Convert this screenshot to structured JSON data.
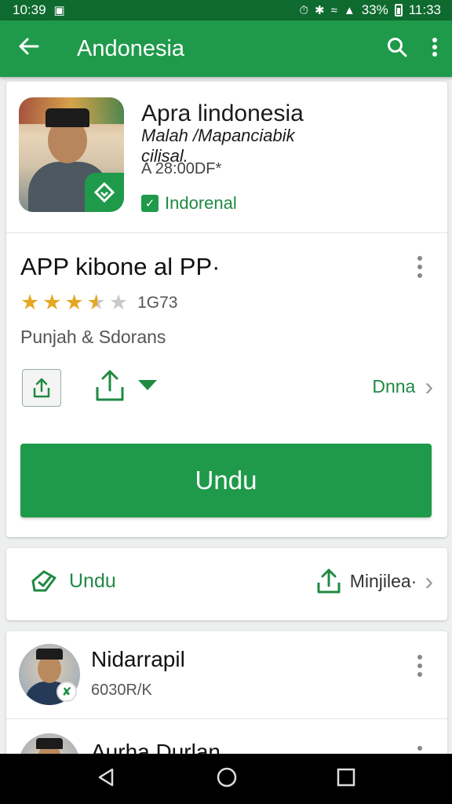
{
  "status_bar": {
    "time_left": "10:39",
    "battery": "33%",
    "time_right": "11:33"
  },
  "app_bar": {
    "title": "Andonesia",
    "icons": [
      "back-arrow-icon",
      "search-icon",
      "more-vert-icon"
    ]
  },
  "app_header": {
    "name": "Apra lindonesia",
    "subtitle": "Malah /Mapanciabik",
    "subtitle_2": "cilisal.",
    "size": "A 28:00DF*",
    "developer": "Indorenal"
  },
  "app_details": {
    "title": "APP kibone al PP·",
    "rating": 3.5,
    "rating_count": "1G73",
    "category": "Punjah & Sdorans",
    "more_link": "Dnna",
    "install_label": "Undu"
  },
  "download_row": {
    "left_label": "Undu",
    "right_label": "Minjilea·"
  },
  "list_items": [
    {
      "name": "Nidarrapil",
      "subtitle": "6030R/K"
    },
    {
      "name": "Aurha Durlan",
      "subtitle": ""
    }
  ],
  "colors": {
    "primary": "#1f9a4a",
    "primary_dark": "#0f6a30",
    "accent_text": "#1f8a42",
    "star": "#e5a823"
  }
}
